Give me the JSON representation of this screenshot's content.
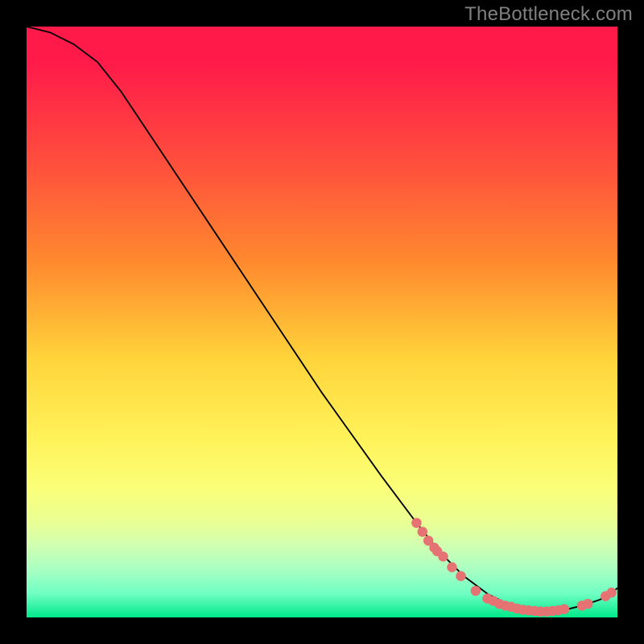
{
  "watermark": "TheBottleneck.com",
  "colors": {
    "background": "#000000",
    "curve": "#000000",
    "points": "#e57373",
    "watermark_text": "#808080"
  },
  "chart_data": {
    "type": "line",
    "title": "",
    "xlabel": "",
    "ylabel": "",
    "xlim": [
      0,
      100
    ],
    "ylim": [
      0,
      100
    ],
    "curve": [
      {
        "x": 0,
        "y": 100
      },
      {
        "x": 4,
        "y": 99
      },
      {
        "x": 8,
        "y": 97
      },
      {
        "x": 12,
        "y": 94
      },
      {
        "x": 16,
        "y": 89
      },
      {
        "x": 22,
        "y": 80
      },
      {
        "x": 30,
        "y": 68
      },
      {
        "x": 40,
        "y": 53
      },
      {
        "x": 50,
        "y": 38
      },
      {
        "x": 60,
        "y": 24
      },
      {
        "x": 66,
        "y": 16
      },
      {
        "x": 70,
        "y": 11
      },
      {
        "x": 74,
        "y": 7
      },
      {
        "x": 78,
        "y": 4
      },
      {
        "x": 82,
        "y": 2
      },
      {
        "x": 86,
        "y": 1
      },
      {
        "x": 90,
        "y": 1
      },
      {
        "x": 94,
        "y": 2
      },
      {
        "x": 97,
        "y": 3
      },
      {
        "x": 99,
        "y": 4
      },
      {
        "x": 100,
        "y": 5
      }
    ],
    "points": [
      {
        "x": 66,
        "y": 16
      },
      {
        "x": 67,
        "y": 14.5
      },
      {
        "x": 68,
        "y": 13
      },
      {
        "x": 69,
        "y": 11.8
      },
      {
        "x": 69.5,
        "y": 11.2
      },
      {
        "x": 70.5,
        "y": 10.3
      },
      {
        "x": 72,
        "y": 8.5
      },
      {
        "x": 73.5,
        "y": 7
      },
      {
        "x": 76,
        "y": 4.5
      },
      {
        "x": 78,
        "y": 3.2
      },
      {
        "x": 79,
        "y": 2.8
      },
      {
        "x": 80,
        "y": 2.3
      },
      {
        "x": 81,
        "y": 2.0
      },
      {
        "x": 82,
        "y": 1.8
      },
      {
        "x": 83,
        "y": 1.5
      },
      {
        "x": 84,
        "y": 1.3
      },
      {
        "x": 85,
        "y": 1.2
      },
      {
        "x": 86,
        "y": 1.1
      },
      {
        "x": 87,
        "y": 1.0
      },
      {
        "x": 88,
        "y": 1.0
      },
      {
        "x": 89,
        "y": 1.1
      },
      {
        "x": 90,
        "y": 1.2
      },
      {
        "x": 91,
        "y": 1.4
      },
      {
        "x": 94,
        "y": 2.0
      },
      {
        "x": 95,
        "y": 2.3
      },
      {
        "x": 98,
        "y": 3.6
      },
      {
        "x": 99,
        "y": 4.2
      }
    ]
  }
}
